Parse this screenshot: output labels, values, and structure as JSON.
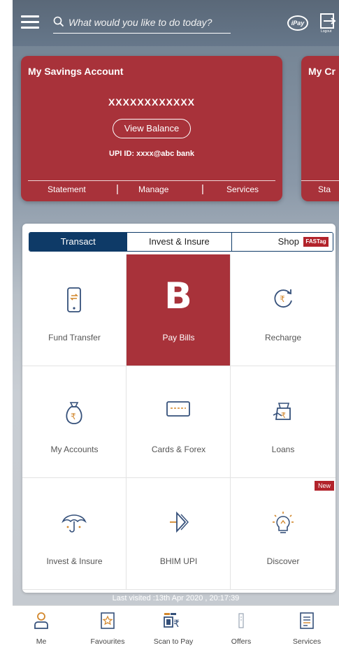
{
  "header": {
    "search_placeholder": "What would you like to do today?",
    "ipay_label": "iPay",
    "logout_label": "Logout"
  },
  "accounts": [
    {
      "title": "My Savings Account",
      "account_number": "XXXXXXXXXXXX",
      "view_balance": "View Balance",
      "upi_id": "UPI ID:  xxxx@abc bank",
      "links": [
        "Statement",
        "Manage",
        "Services"
      ],
      "separator": "|"
    },
    {
      "title": "My Cr",
      "links": [
        "Sta"
      ]
    }
  ],
  "tabs": [
    {
      "label": "Transact",
      "active": true
    },
    {
      "label": "Invest & Insure",
      "active": false
    },
    {
      "label": "Shop",
      "active": false,
      "badge": "FASTag"
    }
  ],
  "grid": [
    {
      "label": "Fund Transfer",
      "icon": "phone-transfer-icon"
    },
    {
      "label": "Pay Bills",
      "icon": "bbps-logo",
      "glyph": "B",
      "selected": true
    },
    {
      "label": "Recharge",
      "icon": "rupee-refresh-icon"
    },
    {
      "label": "My Accounts",
      "icon": "money-bag-icon"
    },
    {
      "label": "Cards & Forex",
      "icon": "card-icon"
    },
    {
      "label": "Loans",
      "icon": "loan-bag-icon"
    },
    {
      "label": "Invest & Insure",
      "icon": "umbrella-icon"
    },
    {
      "label": "BHIM UPI",
      "icon": "bhim-upi-icon"
    },
    {
      "label": "Discover",
      "icon": "bulb-icon",
      "badge": "New"
    }
  ],
  "last_visited": "Last visited :13th Apr 2020 , 20:17:39",
  "bottom_nav": [
    {
      "label": "Me",
      "icon": "person-icon"
    },
    {
      "label": "Favourites",
      "icon": "star-icon"
    },
    {
      "label": "Scan to Pay",
      "icon": "qr-scan-icon"
    },
    {
      "label": "Offers",
      "icon": "offers-icon"
    },
    {
      "label": "Services",
      "icon": "services-list-icon"
    }
  ],
  "colors": {
    "accent_red": "#a8323a",
    "navy": "#0e3a67",
    "icon_orange": "#d2872c"
  }
}
